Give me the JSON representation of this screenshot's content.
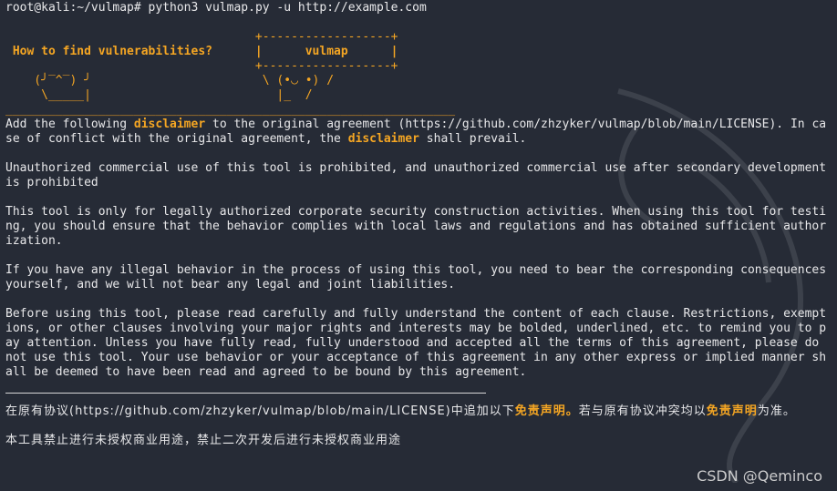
{
  "terminal": {
    "prompt": "root@kali:~/vulmap#",
    "command": " python3 vulmap.py -u http://example.com"
  },
  "banner": {
    "lines": [
      "",
      "                                   +------------------+",
      " How to find vulnerabilities?      |      vulmap      |",
      "                                   +------------------+",
      "    (╯‾^‾) ╯                        \\ (•◡ •) /",
      "     \\_____|                          |_  /",
      "_______________________________________________________________"
    ]
  },
  "disclaimer_en": {
    "p1_a": "Add the following ",
    "p1_hl1": "disclaimer",
    "p1_b": " to the original agreement (https://github.com/zhzyker/vulmap/blob/main/LICENSE). In case of conflict with the original agreement, the ",
    "p1_hl2": "disclaimer",
    "p1_c": " shall prevail.",
    "p2": "Unauthorized commercial use of this tool is prohibited, and unauthorized commercial use after secondary development is prohibited",
    "p3": "This tool is only for legally authorized corporate security construction activities. When using this tool for testing, you should ensure that the behavior complies with local laws and regulations and has obtained sufficient authorization.",
    "p4": "If you have any illegal behavior in the process of using this tool, you need to bear the corresponding consequences yourself, and we will not bear any legal and joint liabilities.",
    "p5": "Before using this tool, please read carefully and fully understand the content of each clause. Restrictions, exemptions, or other clauses involving your major rights and interests may be bolded, underlined, etc. to remind you to pay attention. Unless you have fully read, fully understood and accepted all the terms of this agreement, please do not use this tool. Your use behavior or your acceptance of this agreement in any other express or implied manner shall be deemed to have been read and agreed to be bound by this agreement."
  },
  "disclaimer_cn": {
    "p1_a": "在原有协议(https://github.com/zhzyker/vulmap/blob/main/LICENSE)中追加以下",
    "p1_hl1": "免责声明。",
    "p1_b": "若与原有协议冲突均以",
    "p1_hl2": "免责声明",
    "p1_c": "为准。",
    "p2": "本工具禁止进行未授权商业用途，禁止二次开发后进行未授权商业用途"
  },
  "watermark": "CSDN @Qeminco",
  "colors": {
    "background": "#262b36",
    "text": "#e8e8ea",
    "accent": "#f5a623"
  }
}
